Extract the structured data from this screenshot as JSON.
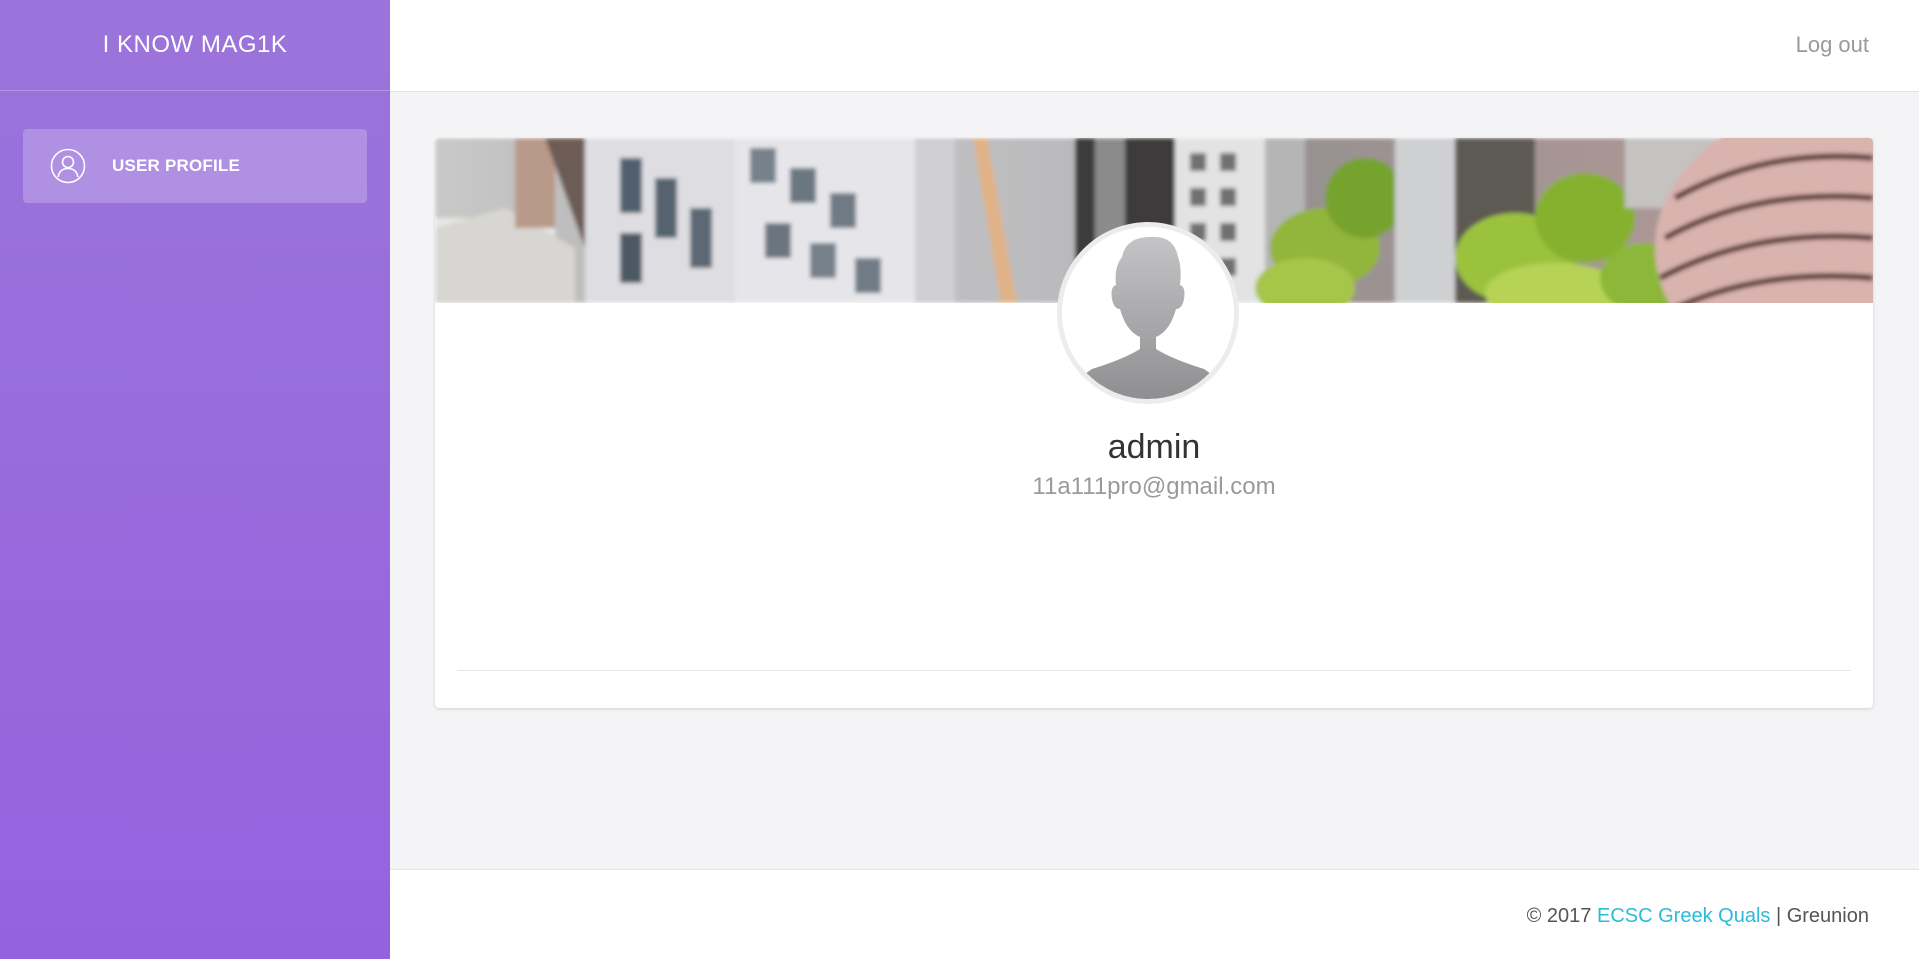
{
  "sidebar": {
    "brand": "I KNOW MAG1K",
    "items": [
      {
        "label": "USER PROFILE",
        "icon": "user-icon",
        "active": true
      }
    ]
  },
  "topbar": {
    "logout_label": "Log out"
  },
  "profile": {
    "username": "admin",
    "email": "11a111pro@gmail.com",
    "avatar_icon": "user-silhouette-icon"
  },
  "footer": {
    "copyright": "© 2017",
    "link_label": "ECSC Greek Quals",
    "separator": "|",
    "author": "Greunion"
  },
  "colors": {
    "sidebar_top": "#9b74db",
    "sidebar_bottom": "#9562de",
    "link": "#2bbbd8",
    "background": "#f4f4f6"
  }
}
